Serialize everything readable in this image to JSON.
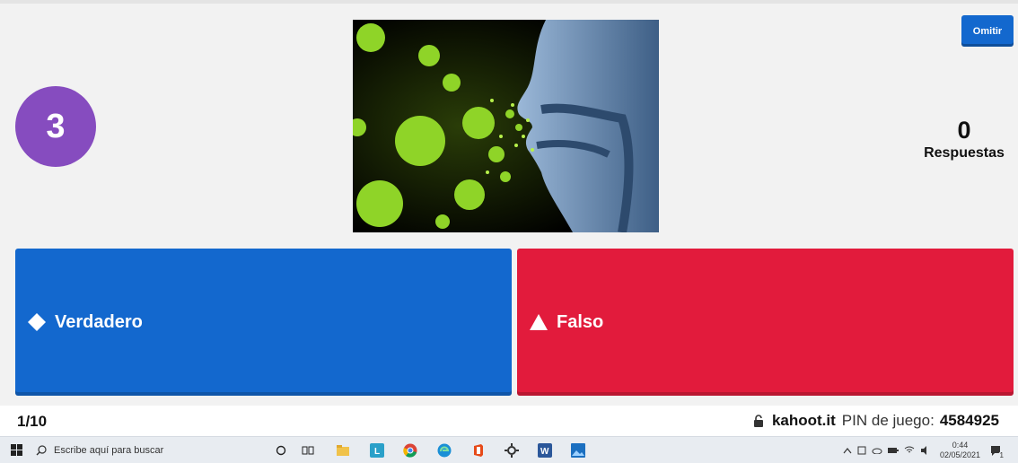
{
  "timer": {
    "value": "3"
  },
  "question_image": {
    "description_icon": "virus-breath-illustration"
  },
  "skip_button": {
    "label": "Omitir"
  },
  "answers_count": {
    "value": "0",
    "label": "Respuestas"
  },
  "answers": [
    {
      "shape": "diamond",
      "label": "Verdadero",
      "color": "#1368ce"
    },
    {
      "shape": "triangle",
      "label": "Falso",
      "color": "#e21b3c"
    }
  ],
  "footer": {
    "question_counter": "1/10",
    "site": "kahoot.it",
    "pin_label": "PIN de juego:",
    "pin": "4584925"
  },
  "taskbar": {
    "search_placeholder": "Escribe aquí para buscar",
    "time": "0:44",
    "date": "02/05/2021",
    "notification_count": "1"
  },
  "colors": {
    "timer": "#864cbf",
    "skip": "#1368ce",
    "background": "#f2f2f2"
  }
}
